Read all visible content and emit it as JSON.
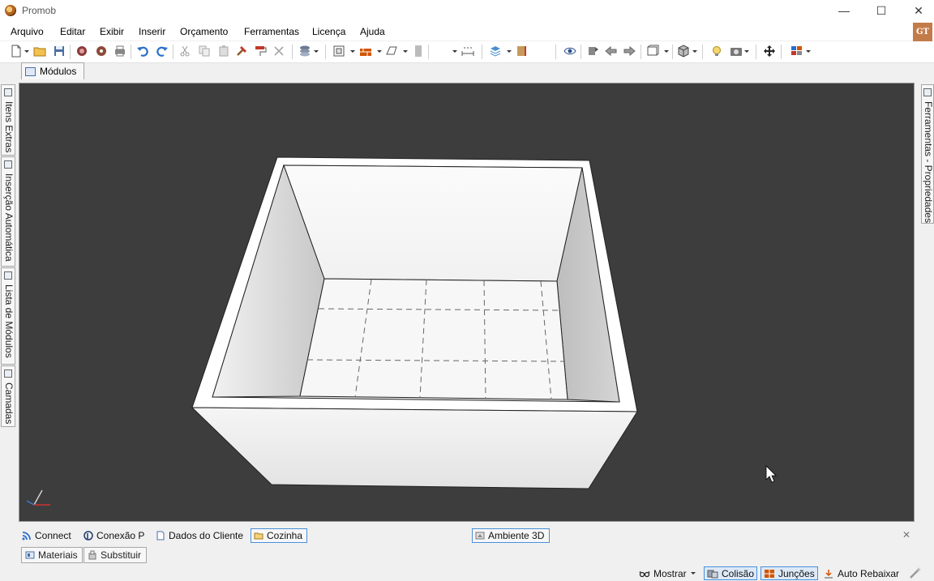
{
  "window": {
    "title": "Promob",
    "minimize": "—",
    "maximize": "☐",
    "close": "✕"
  },
  "menu": {
    "items": [
      "Arquivo",
      "Editar",
      "Exibir",
      "Inserir",
      "Orçamento",
      "Ferramentas",
      "Licença",
      "Ajuda"
    ]
  },
  "user_badge": "GT",
  "doc_tab": {
    "label": "Módulos"
  },
  "left_tabs": [
    "Itens Extras",
    "Inserção Automática",
    "Lista de Módulos",
    "Camadas"
  ],
  "right_tab": {
    "label": "Ferramentas - Propriedades"
  },
  "bottom_tabs": [
    {
      "label": "Connect",
      "icon": "rss-icon"
    },
    {
      "label": "Conexão P",
      "icon": "promob-connect-icon"
    },
    {
      "label": "Dados do Cliente",
      "icon": "document-icon"
    },
    {
      "label": "Cozinha",
      "icon": "folder-icon",
      "active": true
    },
    {
      "label": "Ambiente 3D",
      "icon": "scene-3d-icon",
      "active": true
    }
  ],
  "bottom_close": "✕",
  "bottom_tabs2": [
    {
      "label": "Materiais",
      "icon": "materials-icon"
    },
    {
      "label": "Substituir",
      "icon": "replace-icon"
    }
  ],
  "status": {
    "mostrar": "Mostrar",
    "colisao": "Colisão",
    "juncoes": "Junções",
    "auto_rebaixar": "Auto Rebaixar"
  },
  "colors": {
    "viewport_bg": "#3d3d3d",
    "accent": "#4a90d9",
    "badge": "#c47b4a"
  }
}
